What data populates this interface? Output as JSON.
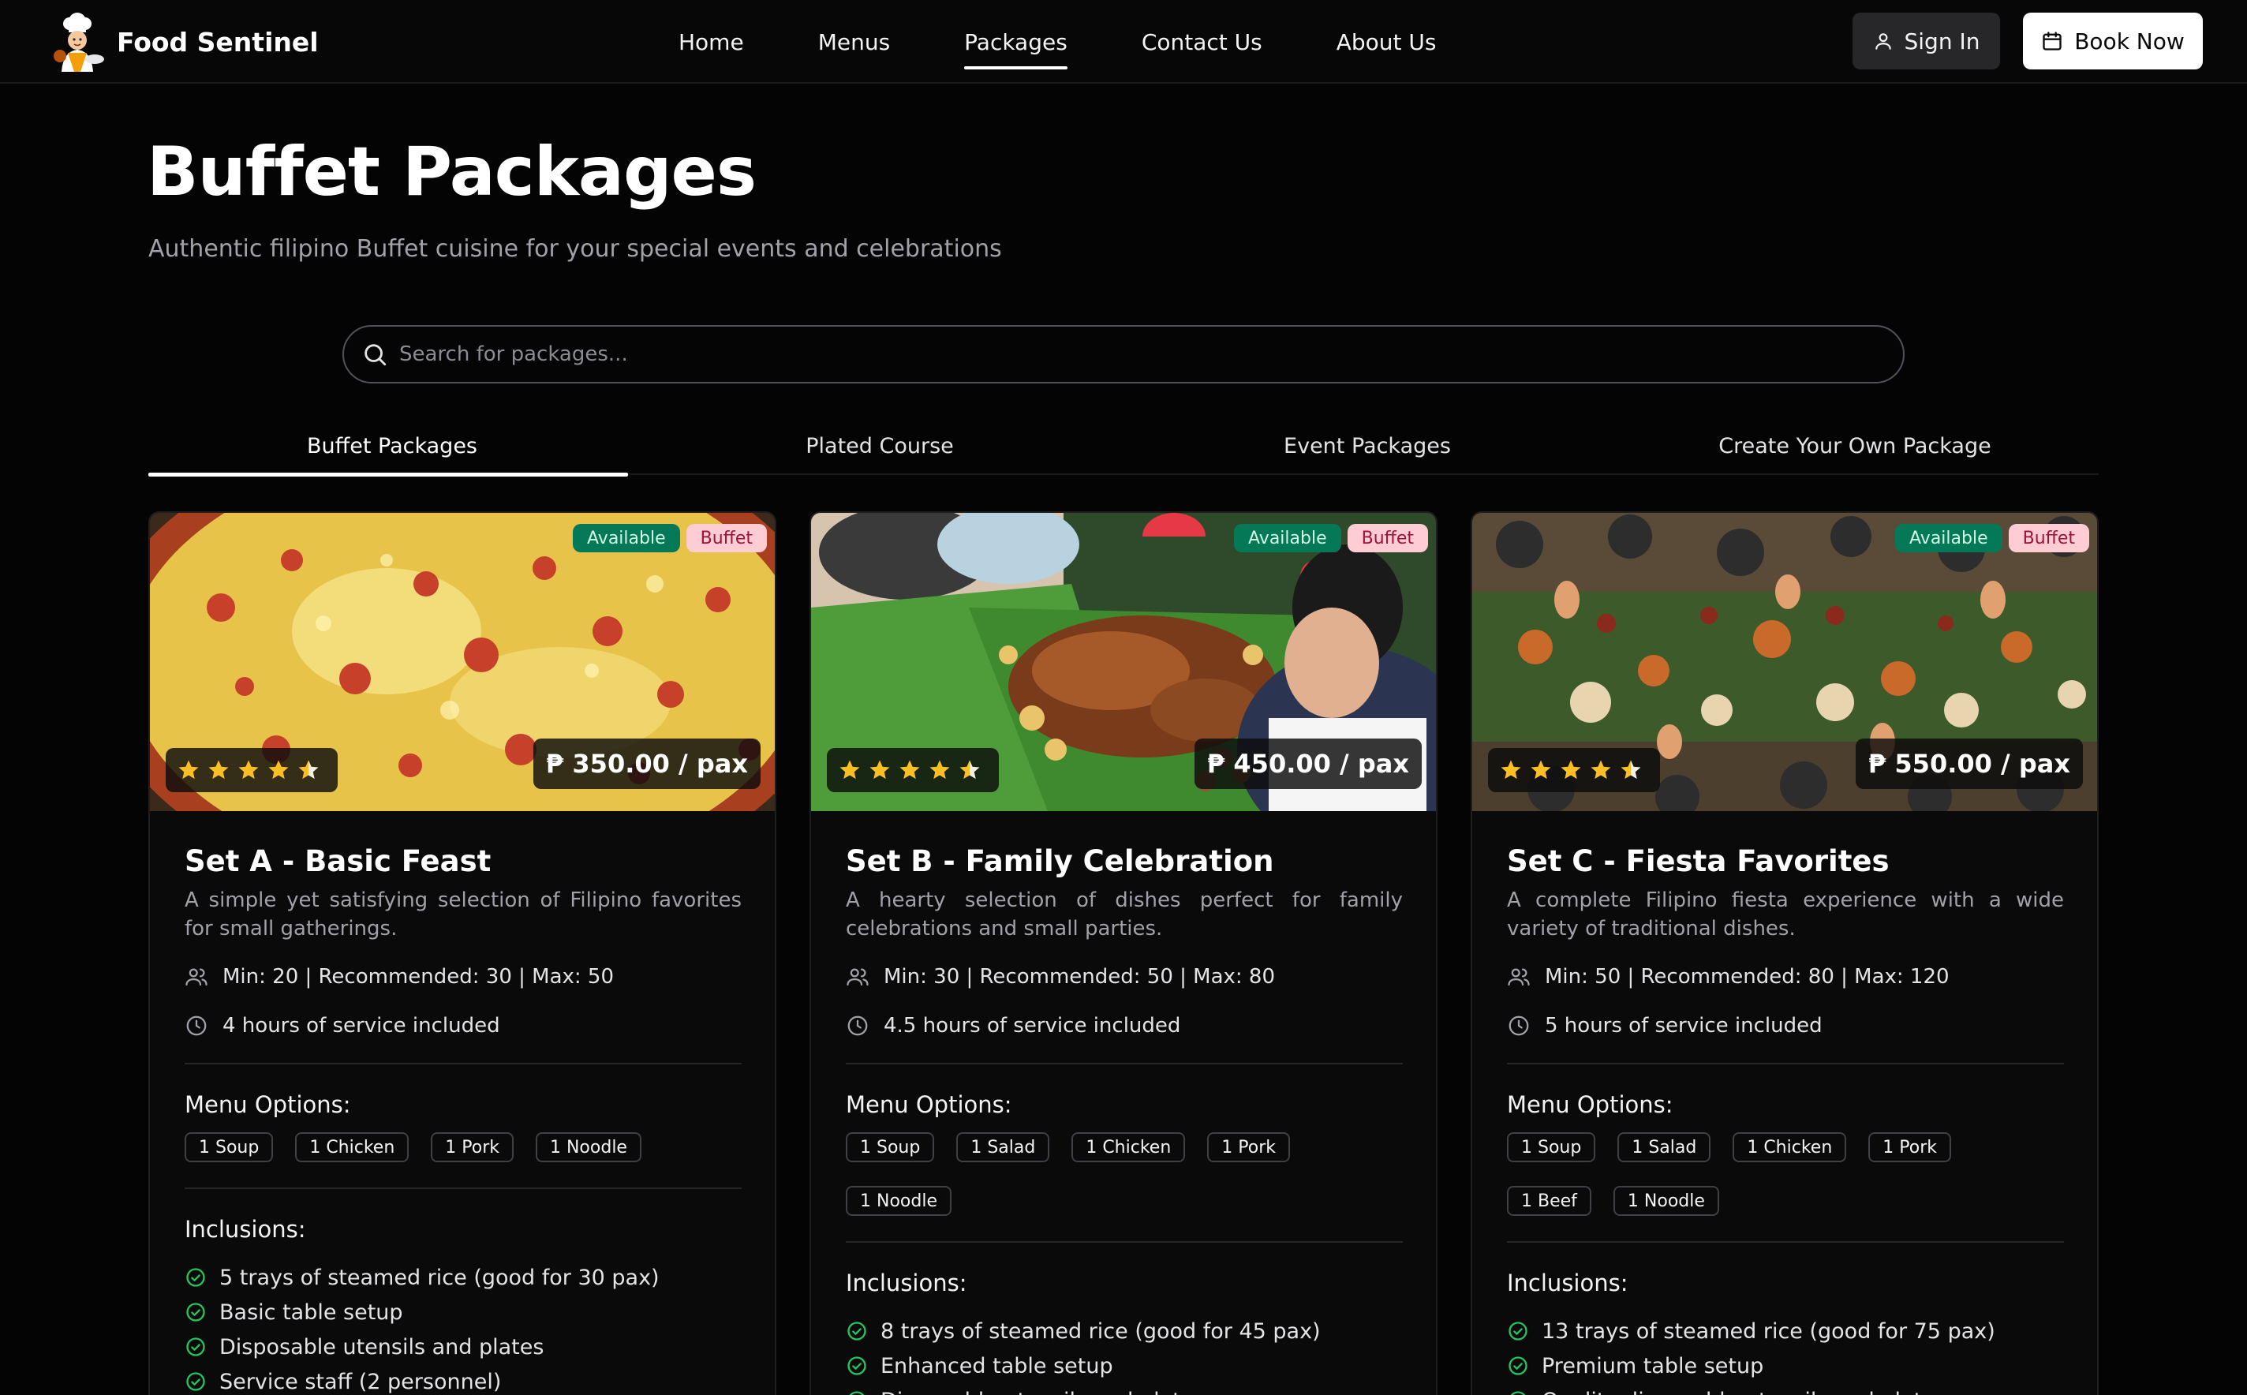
{
  "brand": {
    "name": "Food Sentinel"
  },
  "nav": {
    "links": [
      {
        "label": "Home",
        "active": false
      },
      {
        "label": "Menus",
        "active": false
      },
      {
        "label": "Packages",
        "active": true
      },
      {
        "label": "Contact Us",
        "active": false
      },
      {
        "label": "About Us",
        "active": false
      }
    ],
    "sign_in": "Sign In",
    "book_now": "Book Now"
  },
  "header": {
    "title": "Buffet Packages",
    "subtitle": "Authentic filipino Buffet cuisine for your special events and celebrations"
  },
  "search": {
    "placeholder": "Search for packages..."
  },
  "tabs": [
    {
      "label": "Buffet Packages",
      "active": true
    },
    {
      "label": "Plated Course",
      "active": false
    },
    {
      "label": "Event Packages",
      "active": false
    },
    {
      "label": "Create Your Own Package",
      "active": false
    }
  ],
  "labels": {
    "menu_options": "Menu Options:",
    "inclusions": "Inclusions:"
  },
  "colors": {
    "accent_available": "#047857",
    "accent_buffet": "#fecdd3",
    "star": "#fbbf24",
    "check": "#22c55e"
  },
  "cards": [
    {
      "badge_available": "Available",
      "badge_type": "Buffet",
      "rating": 4.5,
      "price": "₱ 350.00 / pax",
      "title": "Set A - Basic Feast",
      "description": "A simple yet satisfying selection of Filipino favorites for small gatherings.",
      "guests": "Min: 20 | Recommended: 30 | Max: 50",
      "service": "4 hours of service included",
      "menu_options": [
        "1 Soup",
        "1 Chicken",
        "1 Pork",
        "1 Noodle"
      ],
      "inclusions": [
        "5 trays of steamed rice (good for 30 pax)",
        "Basic table setup",
        "Disposable utensils and plates",
        "Service staff (2 personnel)"
      ]
    },
    {
      "badge_available": "Available",
      "badge_type": "Buffet",
      "rating": 4.5,
      "price": "₱ 450.00 / pax",
      "title": "Set B - Family Celebration",
      "description": "A hearty selection of dishes perfect for family celebrations and small parties.",
      "guests": "Min: 30 | Recommended: 50 | Max: 80",
      "service": "4.5 hours of service included",
      "menu_options": [
        "1 Soup",
        "1 Salad",
        "1 Chicken",
        "1 Pork",
        "1 Noodle"
      ],
      "inclusions": [
        "8 trays of steamed rice (good for 45 pax)",
        "Enhanced table setup",
        "Disposable utensils and plates"
      ]
    },
    {
      "badge_available": "Available",
      "badge_type": "Buffet",
      "rating": 4.5,
      "price": "₱ 550.00 / pax",
      "title": "Set C - Fiesta Favorites",
      "description": "A complete Filipino fiesta experience with a wide variety of traditional dishes.",
      "guests": "Min: 50 | Recommended: 80 | Max: 120",
      "service": "5 hours of service included",
      "menu_options": [
        "1 Soup",
        "1 Salad",
        "1 Chicken",
        "1 Pork",
        "1 Beef",
        "1 Noodle"
      ],
      "inclusions": [
        "13 trays of steamed rice (good for 75 pax)",
        "Premium table setup",
        "Quality disposable utensils and plates"
      ]
    }
  ]
}
